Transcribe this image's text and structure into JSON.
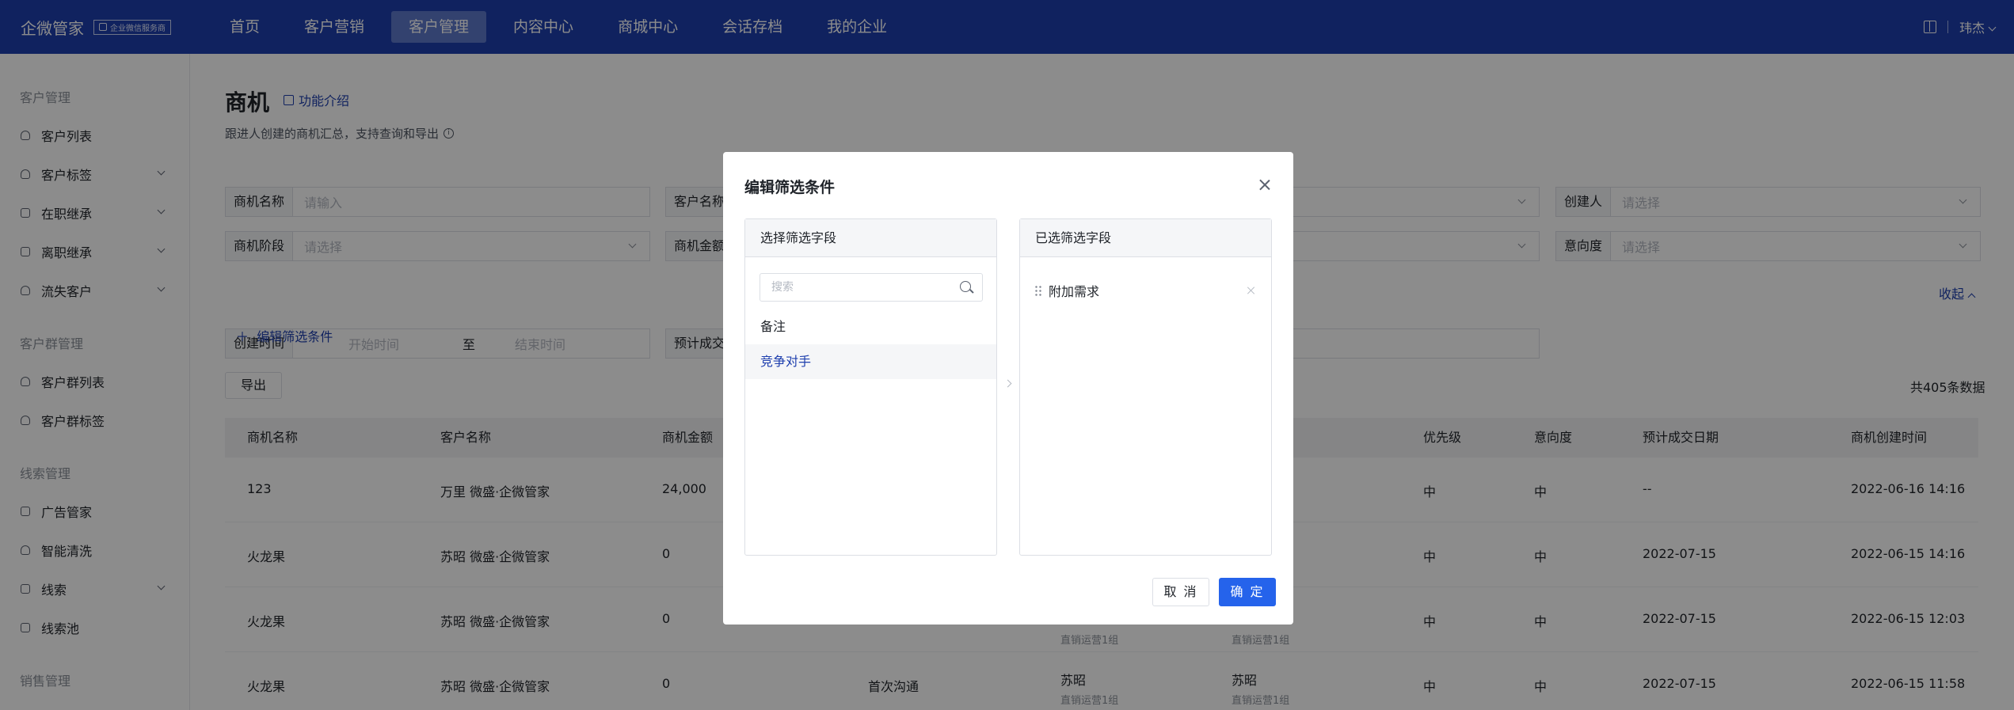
{
  "brand": {
    "title": "企微管家",
    "badge": "企业微信服务商"
  },
  "nav": [
    "首页",
    "客户营销",
    "客户管理",
    "内容中心",
    "商城中心",
    "会话存档",
    "我的企业"
  ],
  "nav_active": 2,
  "user": {
    "name": "玮杰"
  },
  "sidebar": {
    "groups": [
      {
        "title": "客户管理",
        "items": [
          "客户列表",
          "客户标签",
          "在职继承",
          "离职继承",
          "流失客户"
        ]
      },
      {
        "title": "客户群管理",
        "items": [
          "客户群列表",
          "客户群标签"
        ]
      },
      {
        "title": "线索管理",
        "items": [
          "广告管家",
          "智能清洗",
          "线索",
          "线索池"
        ]
      },
      {
        "title": "销售管理",
        "items": []
      }
    ]
  },
  "page": {
    "title": "商机",
    "intro_link": "功能介绍",
    "description": "跟进人创建的商机汇总，支持查询和导出",
    "filters": {
      "opportunity_name": {
        "label": "商机名称",
        "placeholder": "请输入"
      },
      "customer_name": {
        "label": "客户名称"
      },
      "creator": {
        "label": "创建人",
        "placeholder": "请选择"
      },
      "stage": {
        "label": "商机阶段",
        "placeholder": "请选择"
      },
      "amount": {
        "label": "商机金额"
      },
      "intention": {
        "label": "意向度",
        "placeholder": "请选择"
      },
      "created_time": {
        "label": "创建时间",
        "start": "开始时间",
        "to": "至",
        "end": "结束时间"
      },
      "expected_date": {
        "label": "预计成交"
      }
    },
    "edit_filter": "编辑筛选条件",
    "collapse": "收起",
    "export": "导出",
    "total": "共405条数据"
  },
  "table": {
    "headers": [
      "商机名称",
      "客户名称",
      "商机金额",
      "优先级",
      "意向度",
      "预计成交日期",
      "商机创建时间"
    ],
    "rows": [
      {
        "name": "123",
        "customer": "万里 微盛·企微管家",
        "amount": "24,000",
        "stage": "",
        "follower": "",
        "follower_team": "",
        "creator": "",
        "creator_team": "",
        "priority": "中",
        "intention": "中",
        "expected": "--",
        "created": "2022-06-16 14:16"
      },
      {
        "name": "火龙果",
        "customer": "苏昭 微盛·企微管家",
        "amount": "0",
        "stage": "",
        "follower": "",
        "follower_team": "",
        "creator": "",
        "creator_team": "",
        "priority": "中",
        "intention": "中",
        "expected": "2022-07-15",
        "created": "2022-06-15 14:16"
      },
      {
        "name": "火龙果",
        "customer": "苏昭 微盛·企微管家",
        "amount": "0",
        "stage": "",
        "follower": "",
        "follower_team": "直销运营1组",
        "creator": "",
        "creator_team": "直销运营1组",
        "priority": "中",
        "intention": "中",
        "expected": "2022-07-15",
        "created": "2022-06-15 12:03"
      },
      {
        "name": "火龙果",
        "customer": "苏昭 微盛·企微管家",
        "amount": "0",
        "stage": "首次沟通",
        "follower": "苏昭",
        "follower_team": "直销运营1组",
        "creator": "苏昭",
        "creator_team": "直销运营1组",
        "priority": "中",
        "intention": "中",
        "expected": "2022-07-15",
        "created": "2022-06-15 11:58"
      }
    ]
  },
  "modal": {
    "title": "编辑筛选条件",
    "left_title": "选择筛选字段",
    "search_placeholder": "搜索",
    "options": [
      "备注",
      "竞争对手"
    ],
    "active_option": 1,
    "right_title": "已选筛选字段",
    "selected": [
      "附加需求"
    ],
    "cancel": "取 消",
    "ok": "确 定"
  },
  "colors": {
    "topbar": "#1e3fae",
    "primary": "#2563eb",
    "link": "#1e3fae"
  }
}
